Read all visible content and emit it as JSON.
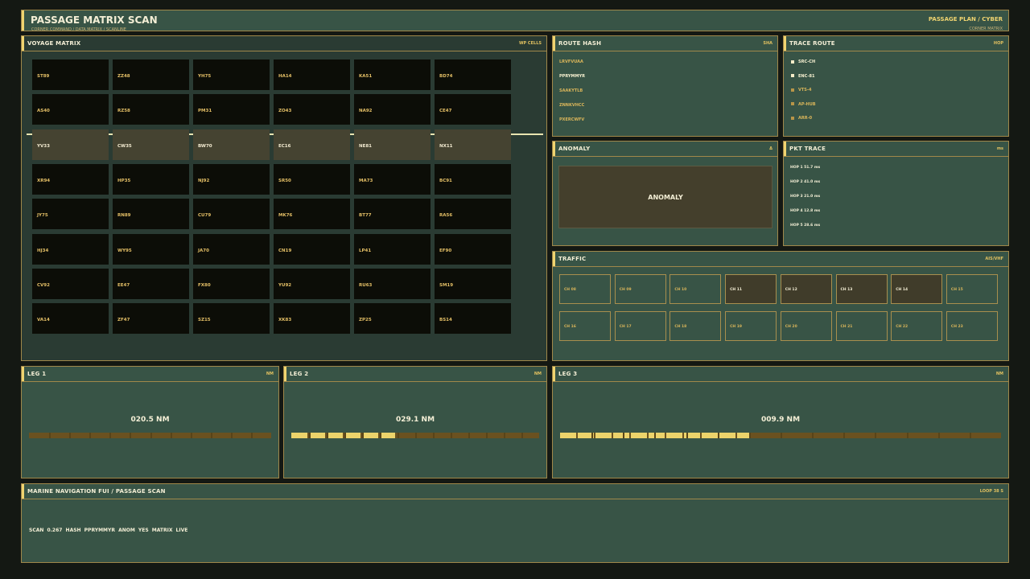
{
  "header": {
    "title": "PASSAGE MATRIX SCAN",
    "subtitle": "CORNER COMMAND / DATA MATRIX / SCANLINE",
    "right": "PASSAGE PLAN / CYBER",
    "right_sub": "CORNER MATRIX"
  },
  "voyage": {
    "title": "VOYAGE MATRIX",
    "tag": "WP CELLS",
    "highlight_row": 2,
    "rows": [
      [
        "ST89",
        "ZZ48",
        "YH75",
        "HA14",
        "KA51",
        "BD74"
      ],
      [
        "AS40",
        "RZ58",
        "PM31",
        "ZO43",
        "NA92",
        "CE47"
      ],
      [
        "YV33",
        "CW35",
        "BW70",
        "EC16",
        "NE81",
        "NX11"
      ],
      [
        "XR94",
        "HP35",
        "NJ92",
        "SR50",
        "MA73",
        "BC91"
      ],
      [
        "JY75",
        "RN89",
        "CU79",
        "MK76",
        "BT77",
        "RA56"
      ],
      [
        "HJ34",
        "WY95",
        "JA70",
        "CN19",
        "LP41",
        "EF90"
      ],
      [
        "CV92",
        "EE47",
        "FX80",
        "YU92",
        "RU63",
        "SM19"
      ],
      [
        "VA14",
        "ZF47",
        "SZ15",
        "XK83",
        "ZP25",
        "BS14"
      ]
    ]
  },
  "route_hash": {
    "title": "ROUTE HASH",
    "tag": "SHA",
    "items": [
      "LRVFVUAA",
      "PPRYMMYR",
      "SAAKYTLB",
      "ZNNKVHCC",
      "PXERCWFV"
    ],
    "active_index": 1
  },
  "trace_route": {
    "title": "TRACE ROUTE",
    "tag": "HOP",
    "items": [
      {
        "label": "SRC-CH",
        "on": true
      },
      {
        "label": "ENC-81",
        "on": true
      },
      {
        "label": "VTS-4",
        "on": false
      },
      {
        "label": "AP-HUB",
        "on": false
      },
      {
        "label": "ARR-0",
        "on": false
      }
    ]
  },
  "anomaly": {
    "title": "ANOMALY",
    "tag": "Δ",
    "label": "ANOMALY"
  },
  "pkt_trace": {
    "title": "PKT TRACE",
    "tag": "ms",
    "items": [
      "HOP 1  51.7 ms",
      "HOP 2  41.0 ms",
      "HOP 3  21.0 ms",
      "HOP 4  12.8 ms",
      "HOP 5  28.6 ms"
    ]
  },
  "traffic": {
    "title": "TRAFFIC",
    "tag": "AIS/VHF",
    "channels": [
      {
        "label": "CH 08",
        "on": false
      },
      {
        "label": "CH 09",
        "on": false
      },
      {
        "label": "CH 10",
        "on": false
      },
      {
        "label": "CH 11",
        "on": true
      },
      {
        "label": "CH 12",
        "on": true
      },
      {
        "label": "CH 13",
        "on": true
      },
      {
        "label": "CH 14",
        "on": true
      },
      {
        "label": "CH 15",
        "on": false
      },
      {
        "label": "CH 16",
        "on": false
      },
      {
        "label": "CH 17",
        "on": false
      },
      {
        "label": "CH 18",
        "on": false
      },
      {
        "label": "CH 19",
        "on": false
      },
      {
        "label": "CH 20",
        "on": false
      },
      {
        "label": "CH 21",
        "on": false
      },
      {
        "label": "CH 22",
        "on": false
      },
      {
        "label": "CH 23",
        "on": false
      }
    ]
  },
  "legs": [
    {
      "title": "LEG 1",
      "tag": "NM",
      "value": "020.5 NM",
      "progress": 0.0,
      "segments": 12
    },
    {
      "title": "LEG 2",
      "tag": "NM",
      "value": "029.1 NM",
      "progress": 0.42,
      "segments": 14
    },
    {
      "title": "LEG 3",
      "tag": "NM",
      "value": "009.9 NM",
      "progress": 0.43,
      "segments": 14
    }
  ],
  "footer": {
    "title": "MARINE NAVIGATION FUI / PASSAGE SCAN",
    "tag": "LOOP 38 S",
    "status": "SCAN 0.267  HASH PPRYMMYR  ANOM YES  MATRIX LIVE"
  },
  "colors": {
    "panel": "#385446",
    "border": "#a0884a",
    "accent": "#f0d470",
    "cell": "#0c0d07",
    "cell_highlight": "#454331"
  }
}
